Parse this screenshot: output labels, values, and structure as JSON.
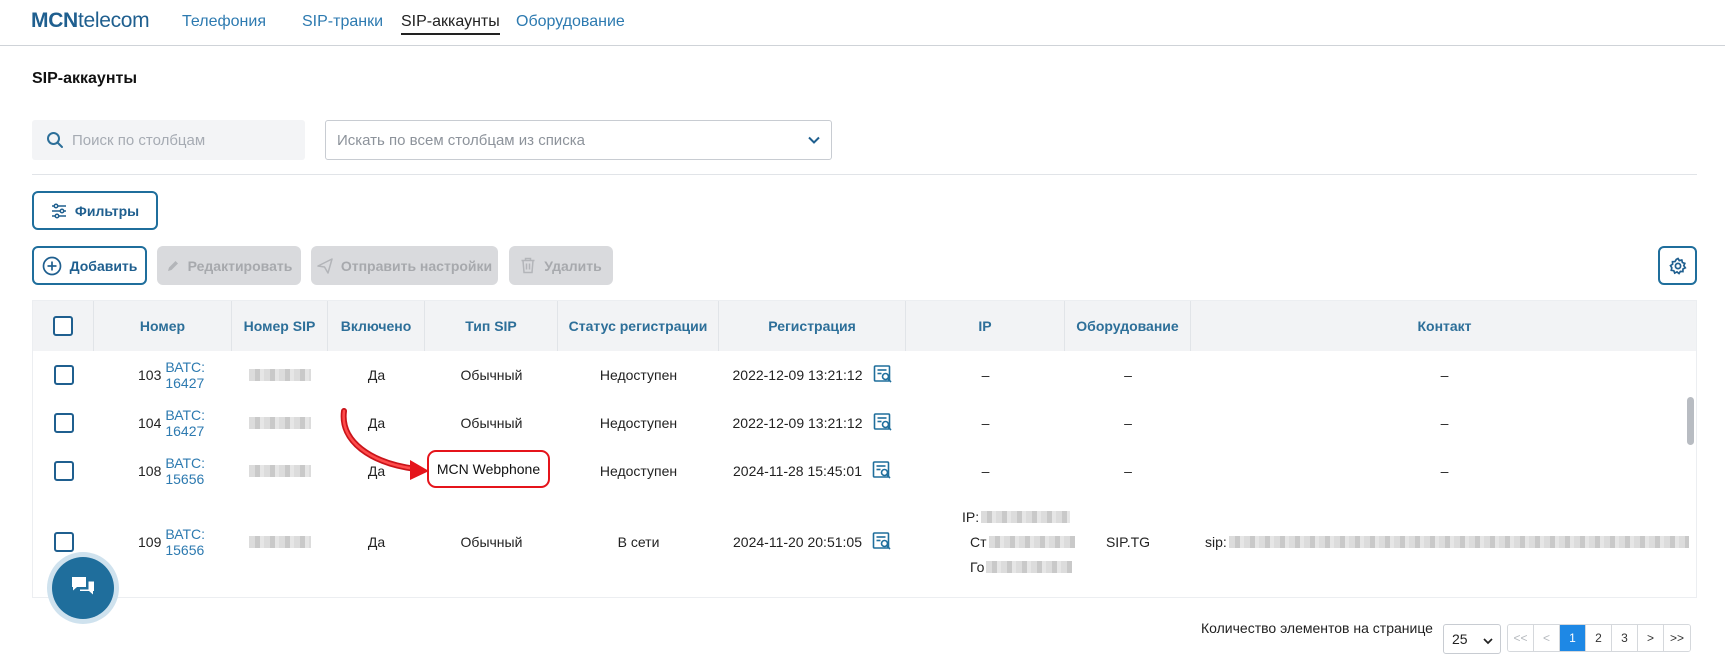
{
  "brand": {
    "logo_bold": "MCN",
    "logo_rest": "telecom"
  },
  "nav": [
    {
      "label": "Телефония",
      "active": false
    },
    {
      "label": "SIP-транки",
      "active": false
    },
    {
      "label": "SIP-аккаунты",
      "active": true
    },
    {
      "label": "Оборудование",
      "active": false
    }
  ],
  "page_title": "SIP-аккаунты",
  "search": {
    "placeholder": "Поиск по столбцам",
    "select_placeholder": "Искать по всем столбцам из списка"
  },
  "buttons": {
    "filters": "Фильтры",
    "add": "Добавить",
    "edit": "Редактировать",
    "send_settings": "Отправить настройки",
    "delete": "Удалить"
  },
  "table": {
    "columns": [
      "Номер",
      "Номер SIP",
      "Включено",
      "Тип SIP",
      "Статус регистрации",
      "Регистрация",
      "IP",
      "Оборудование",
      "Контакт"
    ],
    "rows": [
      {
        "num": "103",
        "batc": "ВАТС: 16427",
        "enabled": "Да",
        "type": "Обычный",
        "status": "Недоступен",
        "reg": "2022-12-09 13:21:12",
        "ip": "–",
        "equip": "–",
        "contact": "–"
      },
      {
        "num": "104",
        "batc": "ВАТС: 16427",
        "enabled": "Да",
        "type": "Обычный",
        "status": "Недоступен",
        "reg": "2022-12-09 13:21:12",
        "ip": "–",
        "equip": "–",
        "contact": "–"
      },
      {
        "num": "108",
        "batc": "ВАТС: 15656",
        "enabled": "Да",
        "type": "MCN Webphone",
        "status": "Недоступен",
        "reg": "2024-11-28 15:45:01",
        "ip": "–",
        "equip": "–",
        "contact": "–"
      },
      {
        "num": "109",
        "batc": "ВАТС: 15656",
        "enabled": "Да",
        "type": "Обычный",
        "status": "В сети",
        "reg": "2024-11-20 20:51:05",
        "ip_lines": [
          "IP:",
          "Ст",
          "Го"
        ],
        "equip": "SIP.TG",
        "contact": "sip:"
      }
    ]
  },
  "pagination": {
    "label": "Количество элементов на странице",
    "per_page": "25",
    "controls": [
      "<<",
      "<",
      "1",
      "2",
      "3",
      ">",
      ">>"
    ],
    "current": "1"
  },
  "icons": [
    "search-icon",
    "chevron-down-icon",
    "filter-sliders-icon",
    "plus-circle-icon",
    "pencil-icon",
    "send-icon",
    "trash-icon",
    "gear-icon",
    "registration-log-icon",
    "chat-icon"
  ],
  "colors": {
    "accent": "#1f6e9c",
    "link": "#2d7ab0",
    "callout": "#e5141b",
    "page_active": "#1e88e5"
  }
}
